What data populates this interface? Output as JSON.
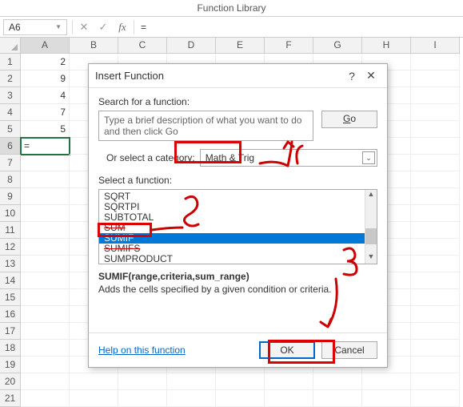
{
  "ribbon_title": "Function Library",
  "name_box": "A6",
  "formula_value": "=",
  "columns": [
    "A",
    "B",
    "C",
    "D",
    "E",
    "F",
    "G",
    "H",
    "I"
  ],
  "rows": {
    "1": {
      "A": "2"
    },
    "2": {
      "A": "9"
    },
    "3": {
      "A": "4"
    },
    "4": {
      "A": "7"
    },
    "5": {
      "A": "5"
    },
    "6": {
      "A": "="
    }
  },
  "row_count": 21,
  "active_cell": "A6",
  "dialog": {
    "title": "Insert Function",
    "search_label": "Search for a function:",
    "search_placeholder": "Type a brief description of what you want to do and then click Go",
    "go": "Go",
    "category_label": "Or select a category:",
    "category_value": "Math & Trig",
    "select_label": "Select a function:",
    "functions": [
      "SQRT",
      "SQRTPI",
      "SUBTOTAL",
      "SUM",
      "SUMIF",
      "SUMIFS",
      "SUMPRODUCT"
    ],
    "selected_function": "SUMIF",
    "signature": "SUMIF(range,criteria,sum_range)",
    "description": "Adds the cells specified by a given condition or criteria.",
    "help": "Help on this function",
    "ok": "OK",
    "cancel": "Cancel"
  }
}
